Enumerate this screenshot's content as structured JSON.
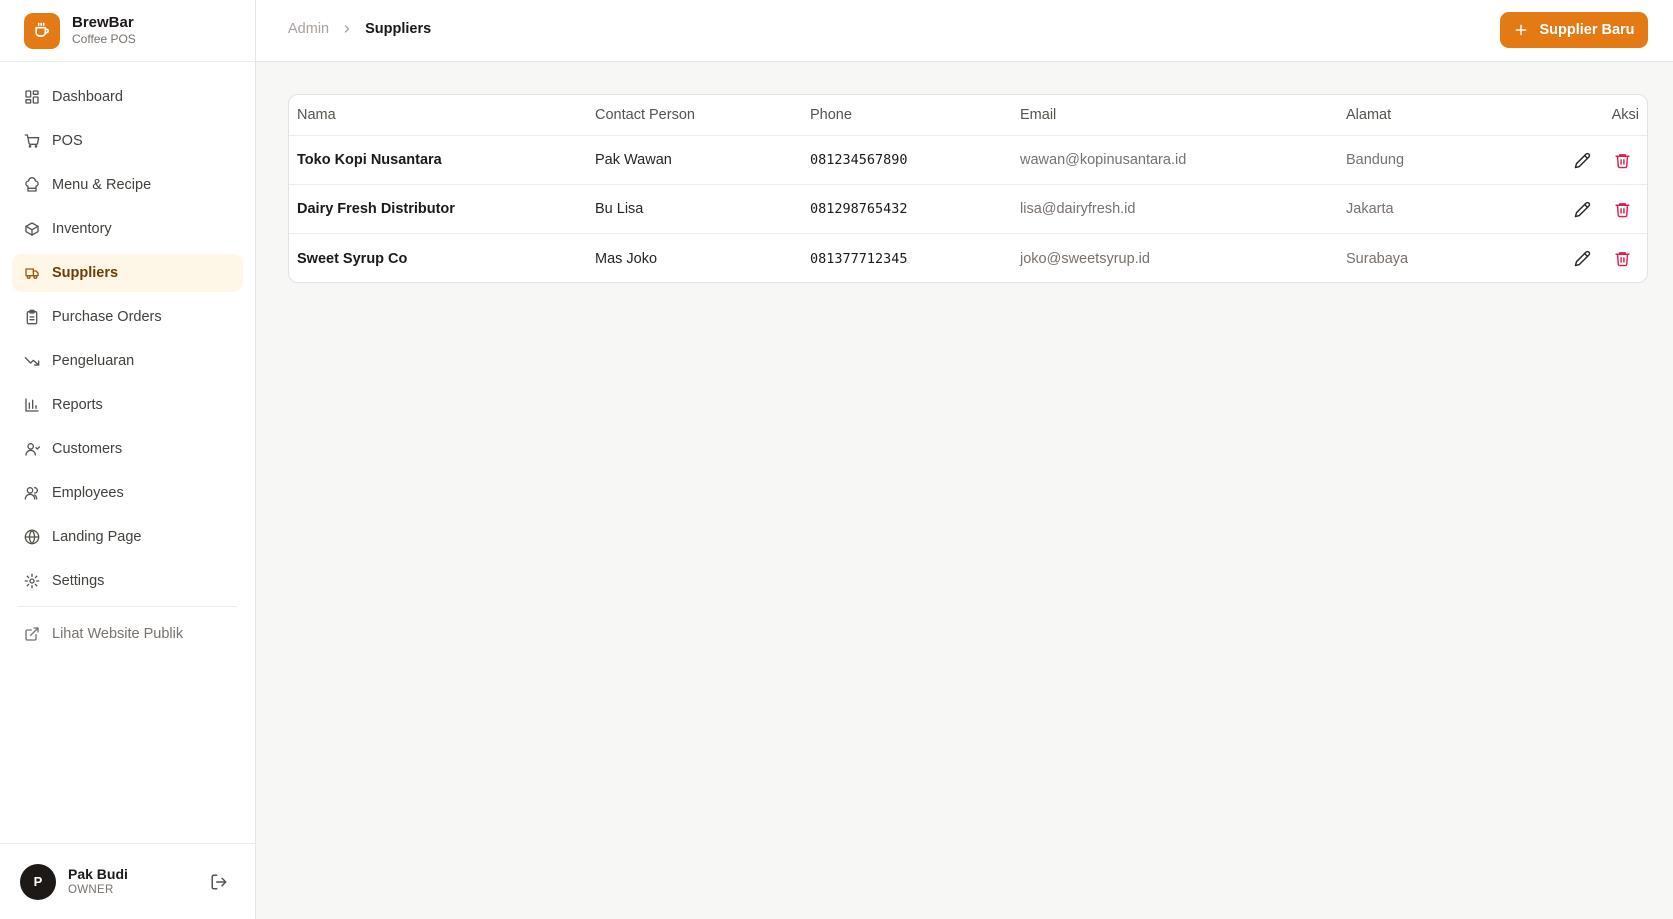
{
  "brand": {
    "name": "BrewBar",
    "subtitle": "Coffee POS",
    "icon": "coffee-cup-icon",
    "color": "#e37a14"
  },
  "sidebar": {
    "items": [
      {
        "label": "Dashboard",
        "icon": "dashboard-grid-icon",
        "active": false
      },
      {
        "label": "POS",
        "icon": "cart-icon",
        "active": false
      },
      {
        "label": "Menu & Recipe",
        "icon": "chef-hat-icon",
        "active": false
      },
      {
        "label": "Inventory",
        "icon": "package-icon",
        "active": false
      },
      {
        "label": "Suppliers",
        "icon": "truck-icon",
        "active": true
      },
      {
        "label": "Purchase Orders",
        "icon": "clipboard-icon",
        "active": false
      },
      {
        "label": "Pengeluaran",
        "icon": "trending-down-icon",
        "active": false
      },
      {
        "label": "Reports",
        "icon": "bar-chart-icon",
        "active": false
      },
      {
        "label": "Customers",
        "icon": "user-icon",
        "active": false
      },
      {
        "label": "Employees",
        "icon": "users-icon",
        "active": false
      },
      {
        "label": "Landing Page",
        "icon": "globe-icon",
        "active": false
      },
      {
        "label": "Settings",
        "icon": "gear-icon",
        "active": false
      }
    ],
    "public_link": {
      "label": "Lihat Website Publik",
      "icon": "external-link-icon"
    }
  },
  "user": {
    "initial": "P",
    "name": "Pak Budi",
    "role": "OWNER"
  },
  "header": {
    "breadcrumb": {
      "root": "Admin",
      "current": "Suppliers"
    },
    "add_button": "Supplier Baru"
  },
  "table": {
    "columns": {
      "nama": "Nama",
      "contact": "Contact Person",
      "phone": "Phone",
      "email": "Email",
      "alamat": "Alamat",
      "aksi": "Aksi"
    },
    "rows": [
      {
        "nama": "Toko Kopi Nusantara",
        "contact": "Pak Wawan",
        "phone": "081234567890",
        "email": "wawan@kopinusantara.id",
        "alamat": "Bandung"
      },
      {
        "nama": "Dairy Fresh Distributor",
        "contact": "Bu Lisa",
        "phone": "081298765432",
        "email": "lisa@dairyfresh.id",
        "alamat": "Jakarta"
      },
      {
        "nama": "Sweet Syrup Co",
        "contact": "Mas Joko",
        "phone": "081377712345",
        "email": "joko@sweetsyrup.id",
        "alamat": "Surabaya"
      }
    ]
  },
  "colors": {
    "accent": "#e37a14",
    "active_bg": "#fef6e6",
    "danger": "#e11d48"
  }
}
